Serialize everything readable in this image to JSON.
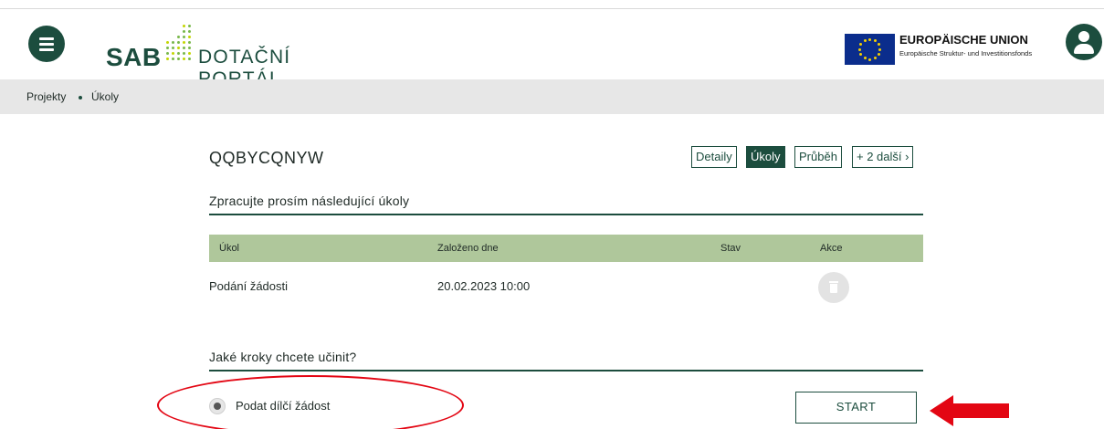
{
  "header": {
    "logo_sab": "SAB",
    "logo_portal": "DOTAČNÍ PORTÁL",
    "eu_title": "EUROPÄISCHE UNION",
    "eu_subtitle": "Europäische Struktur- und Investitionsfonds"
  },
  "breadcrumb": [
    "Projekty",
    "Úkoly"
  ],
  "project": {
    "title": "QQBYCQNYW",
    "tabs": [
      {
        "label": "Detaily",
        "active": false
      },
      {
        "label": "Úkoly",
        "active": true
      },
      {
        "label": "Průběh",
        "active": false
      },
      {
        "label": "+ 2 další ›",
        "active": false
      }
    ]
  },
  "tasks": {
    "heading": "Zpracujte prosím následující úkoly",
    "columns": [
      "Úkol",
      "Založeno dne",
      "Stav",
      "Akce"
    ],
    "rows": [
      {
        "task": "Podání žádosti",
        "created": "20.02.2023 10:00",
        "status": ""
      }
    ]
  },
  "actions": {
    "heading": "Jaké kroky chcete učinit?",
    "option_label": "Podat dílčí žádost",
    "start_label": "START"
  },
  "colors": {
    "primary": "#1c4d3e",
    "table_header": "#afc79b",
    "breadcrumb_bg": "#e7e7e7",
    "annotation_red": "#e30613"
  },
  "icons": [
    "menu-icon",
    "user-icon",
    "eu-flag-icon",
    "trash-icon",
    "arrow-icon"
  ]
}
